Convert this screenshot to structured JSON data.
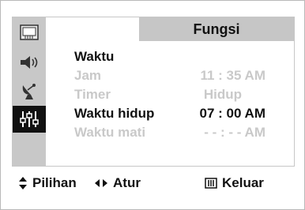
{
  "menu": {
    "title": "Fungsi",
    "items": [
      {
        "label": "Waktu",
        "value": "",
        "state": "enabled"
      },
      {
        "label": "Jam",
        "value": "11 : 35  AM",
        "state": "disabled"
      },
      {
        "label": "Timer",
        "value": "Hidup",
        "state": "disabled"
      },
      {
        "label": "Waktu hidup",
        "value": "07 : 00  AM",
        "state": "enabled"
      },
      {
        "label": "Waktu mati",
        "value": "- - : - -  AM",
        "state": "disabled"
      }
    ],
    "side_icons": [
      {
        "name": "picture-icon"
      },
      {
        "name": "sound-icon"
      },
      {
        "name": "channel-icon"
      },
      {
        "name": "function-icon",
        "active": true
      }
    ]
  },
  "footer": {
    "hints": [
      {
        "icon": "up-down-arrows-icon",
        "label": "Pilihan"
      },
      {
        "icon": "left-right-arrows-icon",
        "label": "Atur"
      },
      {
        "icon": "menu-exit-icon",
        "label": "Keluar"
      }
    ]
  },
  "colors": {
    "panel_bg": "#ffffff",
    "sidebar_bg": "#c8c8c8",
    "title_bar_bg": "#c6c6c6",
    "text_enabled": "#111111",
    "text_disabled": "#c9c9c9",
    "active_icon_bg": "#111111"
  }
}
